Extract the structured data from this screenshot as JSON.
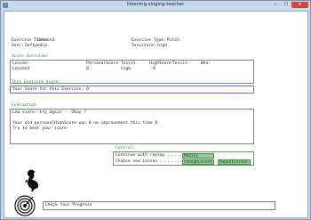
{
  "window": {
    "title": "listening-singing-teacher",
    "controls": {
      "minimize": "—",
      "maximize": "☐",
      "close": "✕"
    }
  },
  "header": {
    "exercise_title_label": "Exercise Title:",
    "exercise_title_value": "Lesson3",
    "user_label": "User:",
    "user_value": "Softpedia",
    "exercise_type_label": "Exercise Type:",
    "exercise_type_value": "Pitch",
    "tessiture_label": "Tessiture:",
    "tessiture_value": "high"
  },
  "score_overview": {
    "label": "Score Overview:",
    "headers": [
      "Lesson:",
      "PersonalScore",
      "Tessit.",
      "HighScore",
      "Tessit.",
      "Who:"
    ],
    "row": [
      "Lesson3",
      "0",
      "high",
      "0",
      "",
      ""
    ]
  },
  "exercise_score": {
    "label": "This Exercise Score:",
    "text": "Your Score for this Exercise: 0"
  },
  "evaluation": {
    "label": "Evaluation:",
    "line1": "Low score: try again -- Okay ?",
    "line2": "Your old personalHighScore was 0 no improvement this time 0",
    "line3": "Try to beat your score"
  },
  "control": {
    "label": "Control:",
    "replay_text": "Continue with replay ........",
    "replay_button": "Modify",
    "choose_text": "Choose new Lesson ..........",
    "change_button": "ChangeLesson",
    "repeat_button": "RepeatLesson"
  },
  "status": {
    "text": "Check Your Progress"
  },
  "icons": {
    "bird": "bird-silhouette-icon",
    "target": "target-icon"
  }
}
